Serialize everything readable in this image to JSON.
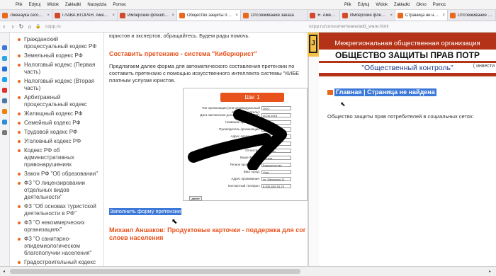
{
  "win1": {
    "menu": [
      "Plik",
      "Edytuj",
      "Widok",
      "Zakładki",
      "Narzędzia",
      "Pomoc"
    ],
    "tabs": [
      {
        "label": "Лженаука сегодня (Алек",
        "color": "#e8681c",
        "active": false
      },
      {
        "label": "ГЛАВА ВТОРАЯ. Америк",
        "color": "#d34a2a",
        "active": false
      },
      {
        "label": "Имперские флешбэки, и",
        "color": "#d34a2a",
        "active": false
      },
      {
        "label": "Общество защиты прав",
        "color": "#e8681c",
        "active": true
      },
      {
        "label": "Отслеживание заказа",
        "color": "#e8681c",
        "active": false
      }
    ],
    "url": "ozpp.ru",
    "left_links": [
      "Гражданский процессуальный кодекс РФ",
      "Земельный кодекс РФ",
      "Налоговый кодекс (Первая часть)",
      "Налоговый кодекс (Вторая часть)",
      "Арбитражный процессуальный кодекс",
      "Жилищный кодекс РФ",
      "Семейный кодекс РФ",
      "Трудовой кодекс РФ",
      "Уголовный кодекс РФ",
      "Кодекс РФ об административных правонарушениях",
      "Закон РФ \"Об образовании\"",
      "ФЗ \"О лицензировании отдельных видов деятельности\"",
      "ФЗ \"Об основах туристской деятельности в РФ\"",
      "ФЗ \"О некоммерческих организациях\"",
      "ФЗ \"О санитарно-эпидемиологическом благополучии населения\"",
      "Градостроительный кодекс РФ"
    ],
    "content": {
      "intro": "юристов и экспертов, обращайтесь. Будем рады помочь.",
      "heading": "Составить претензию - система \"Киберюрист\"",
      "para": "Предлагаем далее форма для автоматического составления претензии по составить претензию с помощью искусственного интеллекта системы \"КИБЕ платным услугам юристов.",
      "fill_link": "Заполнить форму претензии",
      "next_heading": "Михаил Аншаков: Продуктовые карточки - поддержка для сог слоев населения"
    },
    "step_form": {
      "title": "Шаг 1",
      "rows": [
        {
          "label": "Тип организации (или индивидуальный предприниматель):",
          "value": "ООО"
        },
        {
          "label": "Дата заключения договора ДД.ММ.ГГГГ:",
          "value": "30.06.2018"
        },
        {
          "label": "Название организации:",
          "value": "Адидас"
        },
        {
          "label": "Руководитель организации:",
          "value": ""
        },
        {
          "label": "Адрес организации:",
          "value": ""
        },
        {
          "label": "Имя:",
          "value": "Михаил"
        },
        {
          "label": "Отчество:",
          "value": "Петрович"
        },
        {
          "label": "Ваше Ф.И.О.:",
          "value": "Петров"
        },
        {
          "label": "Регион проживания:",
          "value": "Башкортостан"
        },
        {
          "label": "Ваш город:",
          "value": "Уфа"
        },
        {
          "label": "Адрес проживания:",
          "value": "ул. Мичурина 12"
        },
        {
          "label": "Контактный телефон:",
          "value": "8-926-630-53-75"
        }
      ],
      "button": "далее"
    }
  },
  "win2": {
    "menu": [
      "Plik",
      "Edytuj",
      "Widok",
      "Zakładki",
      "Okno",
      "Pomoc"
    ],
    "tabs": [
      {
        "label": "Я. Америк",
        "color": "#d34a2a",
        "active": false
      },
      {
        "label": "Имперские флешбэки, и",
        "color": "#d34a2a",
        "active": false
      },
      {
        "label": "Страница не найдена - Со",
        "color": "#e8681c",
        "active": true
      },
      {
        "label": "Отслеживание заказа",
        "color": "#e8681c",
        "active": false
      }
    ],
    "url": "ozpp.ru/consumer/ware/add_ware.html",
    "banner": {
      "line1": "Межрегиональная общественная организация",
      "line2": "ОБЩЕСТВО ЗАЩИТЫ ПРАВ ПОТР",
      "line3": "\"Общественный контроль\"",
      "line4": "( инвести"
    },
    "breadcrumb": "Главная | Страница не найдена",
    "social": "Общество защиты прав потребителей в социальных сетях:"
  },
  "colors": {
    "accent": "#e8521c",
    "banner": "#b43318",
    "selection": "#3b78d8"
  }
}
